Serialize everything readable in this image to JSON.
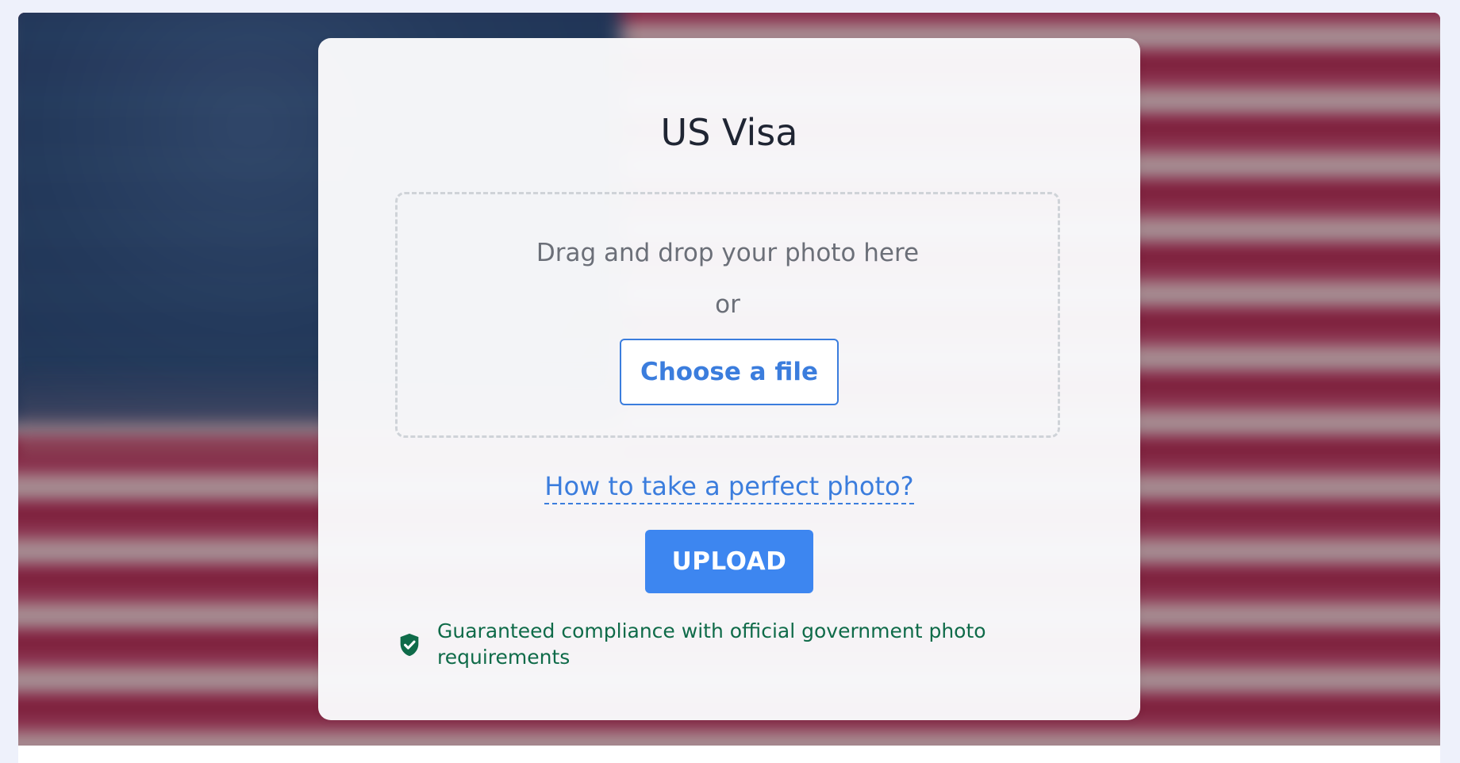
{
  "page": {
    "title": "US Visa"
  },
  "upload": {
    "drag_text": "Drag and drop your photo here",
    "or_text": "or",
    "choose_label": "Choose a file",
    "howto_label": "How to take a perfect photo?",
    "upload_label": "UPLOAD"
  },
  "notice": {
    "icon": "shield-check-icon",
    "text": "Guaranteed compliance with official government photo requirements"
  },
  "colors": {
    "accent": "#3b7ddd",
    "upload_button": "#3d86f0",
    "success": "#0f6b49",
    "title": "#1f2533"
  }
}
